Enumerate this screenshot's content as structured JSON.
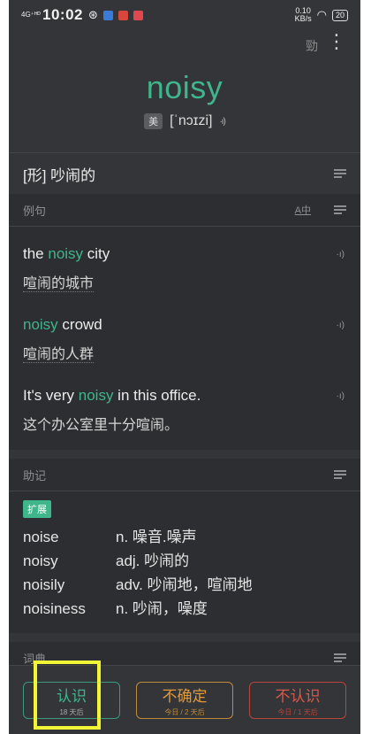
{
  "status": {
    "network": "4G⁺ᴴᴰ",
    "time": "10:02",
    "speed_top": "0.10",
    "speed_unit": "KB/s",
    "battery": "20"
  },
  "toolbar": {
    "brush_glyph": "勁",
    "more_glyph": "⋮"
  },
  "word": {
    "headword": "noisy",
    "region": "美",
    "phonetic": "[ˈnɔɪzi]",
    "speaker": "·ı)"
  },
  "definition": {
    "text": "[形] 吵闹的"
  },
  "examples_section": {
    "title": "例句",
    "translate_toggle": "A中",
    "items": [
      {
        "before": "the ",
        "hl": "noisy",
        "after": " city",
        "zh": "喧闹的城市",
        "speaker": "·ı)"
      },
      {
        "before": "",
        "hl": "noisy",
        "after": " crowd",
        "zh": "喧闹的人群",
        "speaker": "·ı)"
      },
      {
        "before": "It's very ",
        "hl": "noisy",
        "after": " in this office.",
        "zh": "这个办公室里十分喧闹。",
        "speaker": "·ı)"
      }
    ]
  },
  "memo_section": {
    "title": "助记",
    "tag": "扩展",
    "forms": [
      {
        "word": "noise",
        "meaning": "n. 噪音.噪声"
      },
      {
        "word": "noisy",
        "meaning": "adj. 吵闹的"
      },
      {
        "word": "noisily",
        "meaning": "adv. 吵闹地，喧闹地"
      },
      {
        "word": "noisiness",
        "meaning": "n. 吵闹，噪度"
      }
    ]
  },
  "dict_section": {
    "title": "词典"
  },
  "actions": {
    "know": {
      "label": "认识",
      "sub": "18 天后"
    },
    "unsure": {
      "label": "不确定",
      "sub": "今日 / 2 天后"
    },
    "unknown": {
      "label": "不认识",
      "sub": "今日 / 1 天后"
    }
  },
  "colors": {
    "accent": "#3fb58c",
    "background": "#333538",
    "panel": "#2c2e31",
    "unsure": "#e09a3c",
    "unknown": "#d9584a",
    "highlight": "#f1f536"
  }
}
